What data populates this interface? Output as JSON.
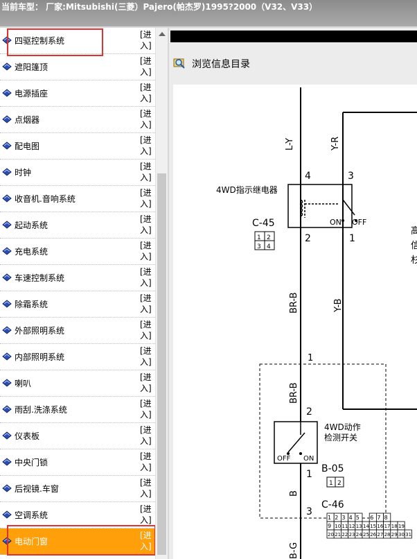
{
  "window": {
    "title": "当前车型：  厂家:Mitsubishi(三菱）Pajero(帕杰罗)1995?2000（V32、V33）"
  },
  "sidebar": {
    "enter_label": "[进\n入]",
    "items": [
      {
        "label": "四驱控制系统"
      },
      {
        "label": "遮阳篷顶"
      },
      {
        "label": "电源插座"
      },
      {
        "label": "点烟器"
      },
      {
        "label": "配电图"
      },
      {
        "label": "时钟"
      },
      {
        "label": "收音机.音响系统"
      },
      {
        "label": "起动系统"
      },
      {
        "label": "充电系统"
      },
      {
        "label": "车速控制系统"
      },
      {
        "label": "除霜系统"
      },
      {
        "label": "外部照明系统"
      },
      {
        "label": "内部照明系统"
      },
      {
        "label": "喇叭"
      },
      {
        "label": "雨刮.洗涤系统"
      },
      {
        "label": "仪表板"
      },
      {
        "label": "中央门锁"
      },
      {
        "label": "后视镜.车窗"
      },
      {
        "label": "空调系统"
      },
      {
        "label": "电动门窗"
      }
    ],
    "active_index": 19
  },
  "main": {
    "browse_label": "浏览信息目录"
  },
  "diagram": {
    "wire_ly": "L-Y",
    "wire_yr": "Y-R",
    "pin_4": "4",
    "pin_3": "3",
    "relay_label": "4WD指示继电器",
    "conn_c45": "C-45",
    "c45_pins": [
      "1",
      "2",
      "3",
      "4"
    ],
    "pin_2": "2",
    "pin_1": "1",
    "on": "ON",
    "off": "OFF",
    "wire_brb": "BR-B",
    "wire_yb": "Y-B",
    "pin_1b": "1",
    "wire_brb2": "BR-B",
    "pin_2b": "2",
    "switch_label_1": "4WD动作",
    "switch_label_2": "检测开关",
    "sw_off": "OFF",
    "sw_on": "ON",
    "conn_b05": "B-05",
    "b05_pins": [
      "1",
      "2"
    ],
    "pin_1c": "1",
    "wire_b": "B",
    "conn_c46": "C-46",
    "pin_3b": "3",
    "wire_bg": "B-G",
    "c46_row1": [
      "1",
      "2",
      "3",
      "4",
      "5",
      "",
      "6",
      "7",
      "8"
    ],
    "c46_row2": [
      "9",
      "10",
      "11",
      "12",
      "13",
      "14",
      "15",
      "16",
      "17",
      "18",
      "19"
    ],
    "c46_row3": [
      "20",
      "21",
      "22",
      "23",
      "24",
      "25",
      "26",
      "27",
      "28",
      "29",
      "30",
      "31"
    ],
    "right_edge_text": [
      "高",
      "信",
      "杉"
    ]
  },
  "colors": {
    "active_bg": "#ff9f0a",
    "highlight": "#e0322f"
  }
}
